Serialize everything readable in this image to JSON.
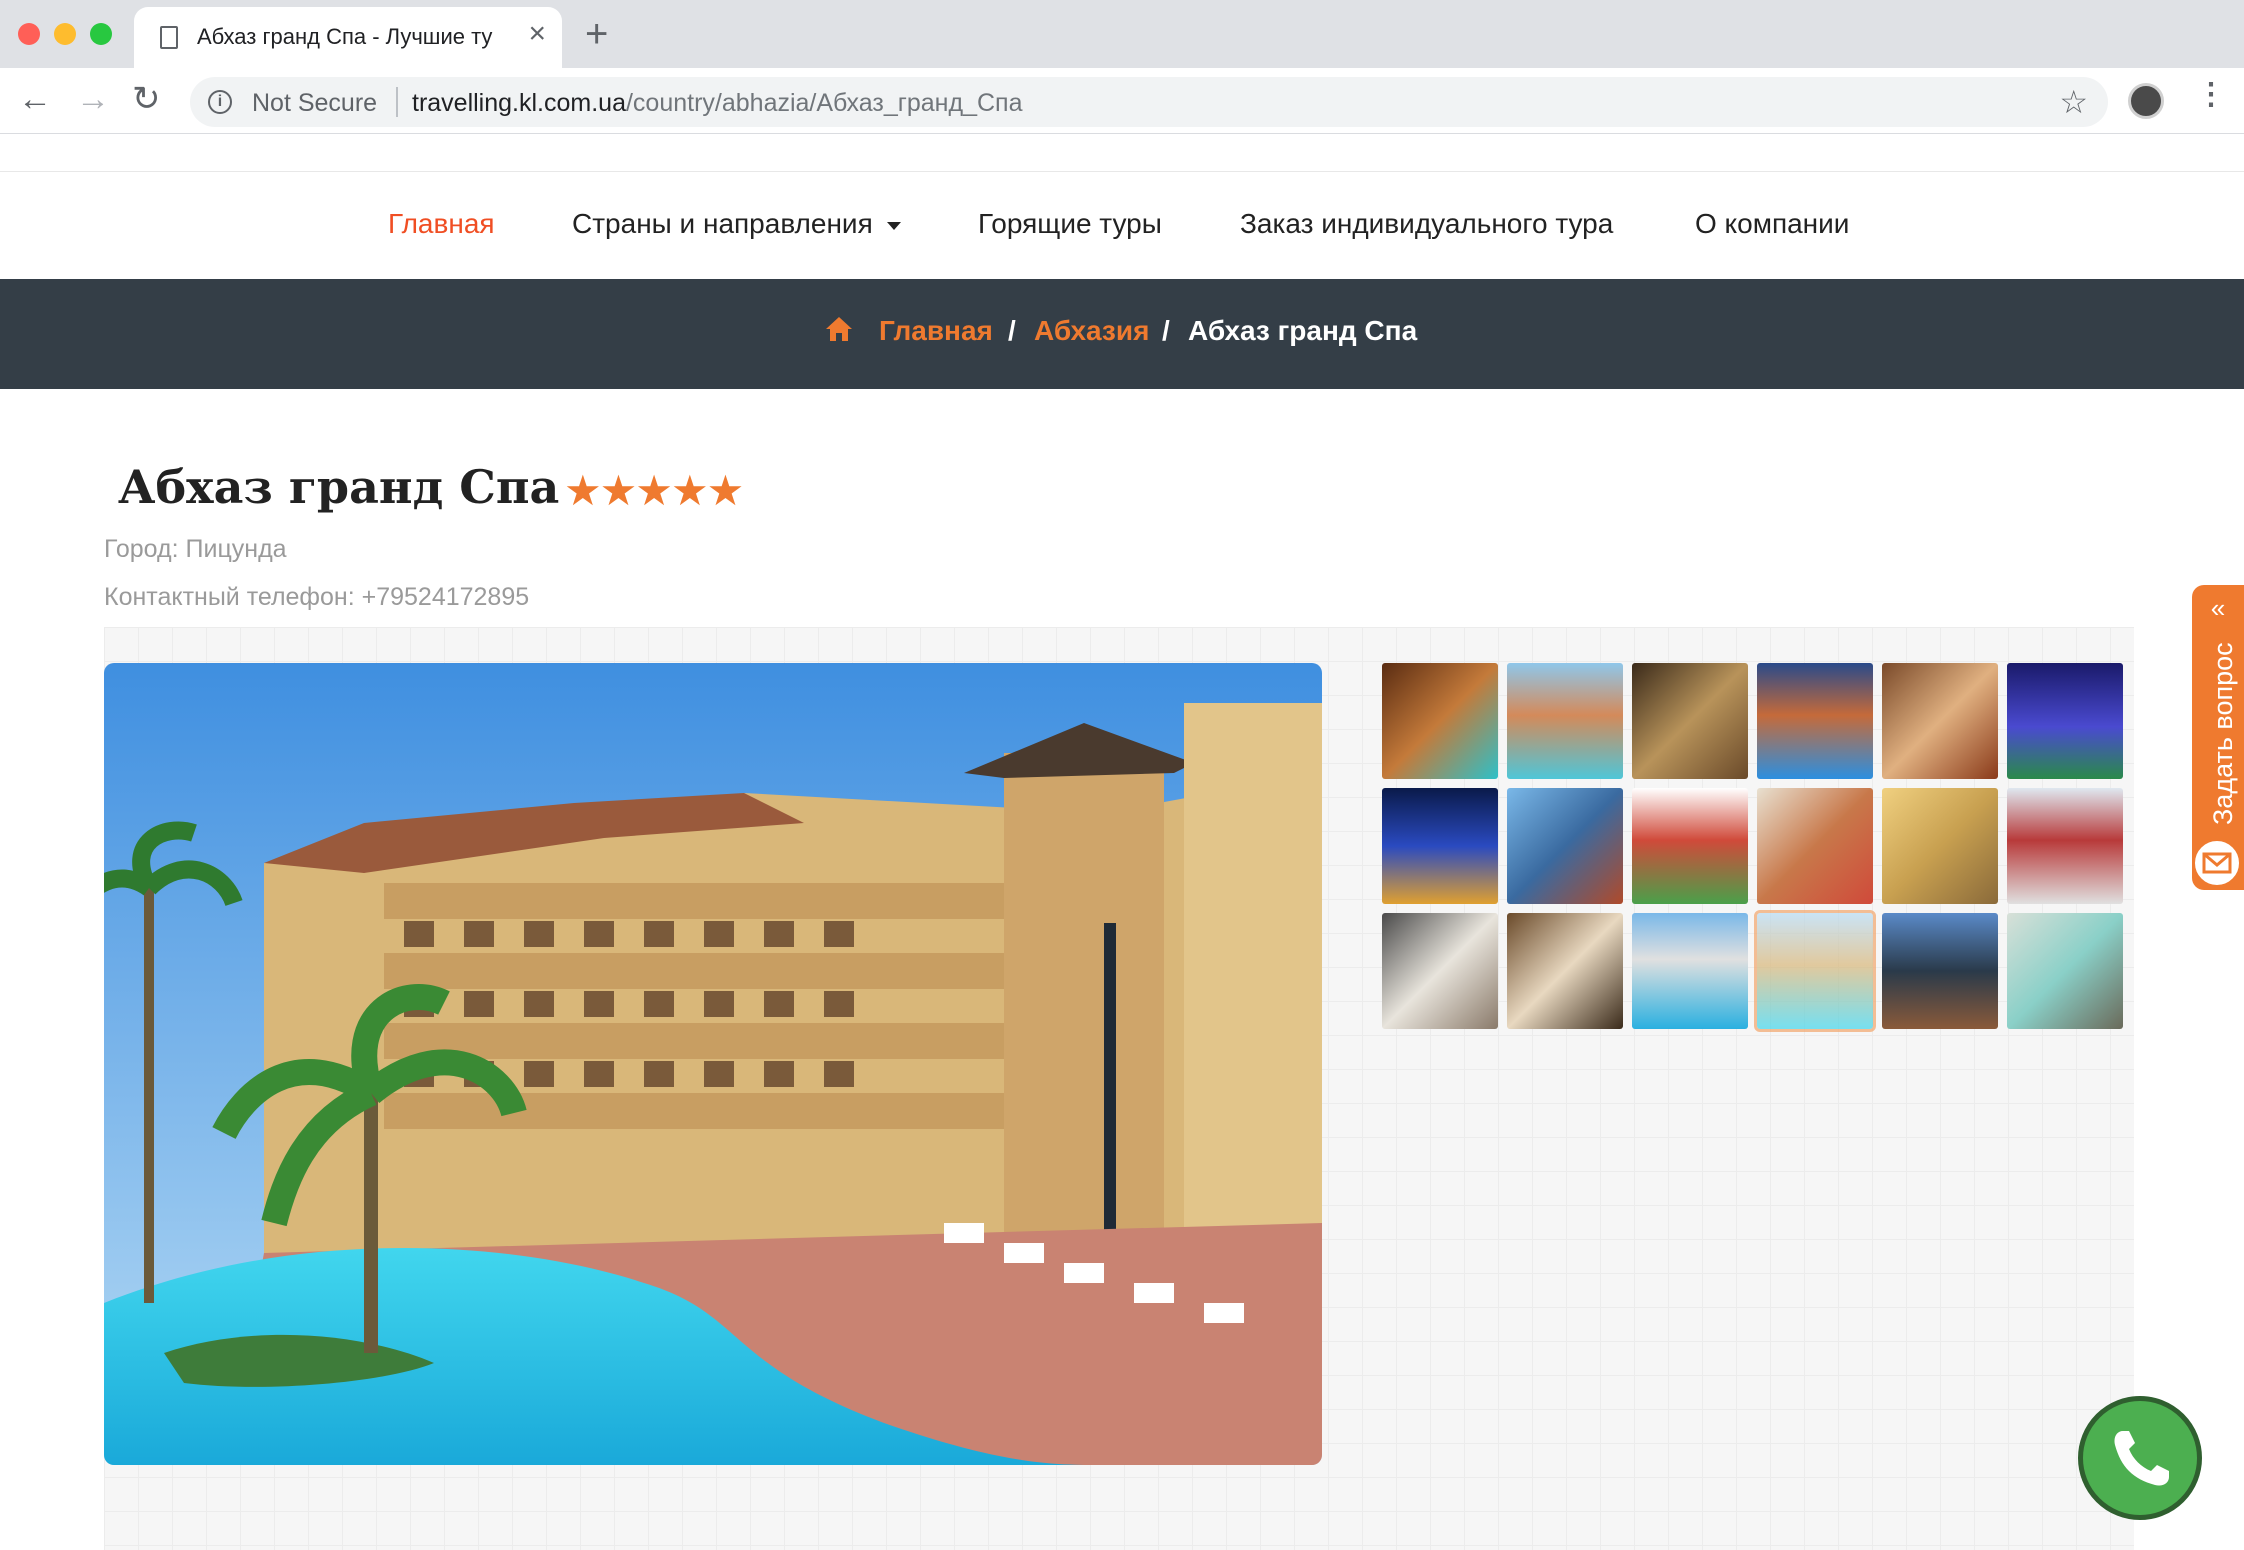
{
  "browser": {
    "tab_title": "Абхаз гранд Спа - Лучшие ту",
    "new_tab": "+",
    "security_label": "Not Secure",
    "url_host": "travelling.kl.com.ua",
    "url_path": "/country/abhazia/Абхаз_гранд_Спа",
    "traffic_colors": [
      "#ff5f57",
      "#febc2e",
      "#28c840"
    ]
  },
  "nav": {
    "items": [
      {
        "label": "Главная",
        "active": true
      },
      {
        "label": "Страны и направления",
        "dropdown": true
      },
      {
        "label": "Горящие туры"
      },
      {
        "label": "Заказ индивидуального тура"
      },
      {
        "label": "О компании"
      }
    ]
  },
  "breadcrumb": {
    "home": "Главная",
    "country": "Абхазия",
    "current": "Абхаз гранд Спа",
    "separator": "/"
  },
  "hotel": {
    "name": "Абхаз гранд Спа",
    "stars_text": "★★★★★",
    "rating": 5,
    "city": "Город: Пицунда",
    "phone": "Контактный телефон: +79524172895"
  },
  "gallery": {
    "thumb_count": 18,
    "active_thumb": 16
  },
  "widget": {
    "ask_label": "Задать вопрос",
    "ask_chevron": "«"
  },
  "colors": {
    "accent": "#ef7a2f",
    "nav_active": "#f04e23",
    "band": "#343e47",
    "call_button": "#4caf50"
  }
}
